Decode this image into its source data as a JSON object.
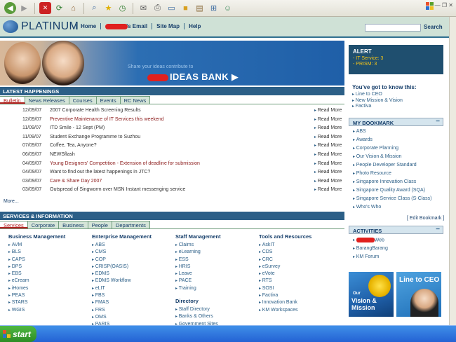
{
  "brand": {
    "name": "PLATINUM"
  },
  "nav": {
    "home": "Home",
    "email": "'s Email",
    "sitemap": "Site Map",
    "help": "Help"
  },
  "search": {
    "button": "Search"
  },
  "banner": {
    "tagline": "Share your ideas contribute to",
    "title": "IDEAS BANK"
  },
  "latest": {
    "heading": "LATEST HAPPENINGS",
    "tabs": [
      "Bulletin",
      "News Releases",
      "Courses",
      "Events",
      "RC News"
    ],
    "items": [
      {
        "date": "12/09/07",
        "title": "2007 Corporate Health Screening Results",
        "more": "Read More"
      },
      {
        "date": "12/09/07",
        "title": "Preventive Maintenance of IT Services this weekend",
        "more": "Read More"
      },
      {
        "date": "11/09/07",
        "title": "ITD Smile - 12 Sept (PM)",
        "more": "Read More"
      },
      {
        "date": "11/09/07",
        "title": "Student Exchange Programme to Suzhou",
        "more": "Read More"
      },
      {
        "date": "07/09/07",
        "title": "Coffee, Tea, Anyone?",
        "more": "Read More"
      },
      {
        "date": "06/09/07",
        "title": "NEWSflash",
        "more": "Read More"
      },
      {
        "date": "04/09/07",
        "title": "Young Designers' Competition - Extension of deadline for submission",
        "more": "Read More"
      },
      {
        "date": "04/09/07",
        "title": "Want to find out the latest happenings in JTC?",
        "more": "Read More"
      },
      {
        "date": "03/09/07",
        "title": "Care & Share Day 2007",
        "more": "Read More"
      },
      {
        "date": "03/09/07",
        "title": "Outspread of Singworm over MSN Instant messenging service",
        "more": "Read More"
      }
    ],
    "more": "More..."
  },
  "services": {
    "heading": "SERVICES & INFORMATION",
    "tabs": [
      "Services",
      "Corporate",
      "Business",
      "People",
      "Departments"
    ],
    "cols": [
      {
        "title": "Business Management",
        "items": [
          "AVM",
          "BLS",
          "CAPS",
          "DPS",
          "EBS",
          "eCream",
          "iHomes",
          "PEAS",
          "STARS",
          "WGIS"
        ]
      },
      {
        "title": "Enterprise Management",
        "items": [
          "ABS",
          "CMS",
          "COP",
          "CRISP(OASIS)",
          "EDMS",
          "EDMS Workflow",
          "eLIT",
          "FBS",
          "FMAS",
          "FRS",
          "OMS",
          "PARIS"
        ]
      },
      {
        "title": "Staff Management",
        "items": [
          "Claims",
          "eLearning",
          "ESS",
          "HRIS",
          "Leave",
          "PACE",
          "Training"
        ]
      },
      {
        "title": "Tools and Resources",
        "items": [
          "AskIT",
          "CDS",
          "CRC",
          "eSurvey",
          "eVote",
          "RTS",
          "SOSI",
          "Factiva",
          "Innovation Bank",
          "KM Workspaces"
        ]
      }
    ],
    "directory": {
      "title": "Directory",
      "items": [
        "Staff Directory",
        "Banks & Others",
        "Government Sites"
      ]
    }
  },
  "alert": {
    "title": "ALERT",
    "items": [
      "- IT Service: 3",
      "- PRISM: 3"
    ]
  },
  "know": {
    "title": "You've got to know this:",
    "items": [
      "Line to CEO",
      "New Mission & Vision",
      "Factiva"
    ]
  },
  "bookmark": {
    "title": "MY BOOKMARK",
    "items": [
      "ABS",
      "Awards",
      "Corporate Planning",
      "Our Vision & Mission",
      "People Developer Standard",
      "Photo Resource",
      "Singapore Innovation Class",
      "Singapore Quality Award (SQA)",
      "Singapore Service Class (S-Class)",
      "Who's Who"
    ],
    "edit": "[ Edit Bookmark ]"
  },
  "activities": {
    "title": "ACTIVITIES",
    "items": [
      "Web",
      "BarangBarang",
      "KM Forum"
    ]
  },
  "ads": {
    "vision": "Vision & Mission",
    "vision_top": "Our",
    "ceo": "Line to CEO"
  },
  "taskbar": {
    "start": "start"
  }
}
